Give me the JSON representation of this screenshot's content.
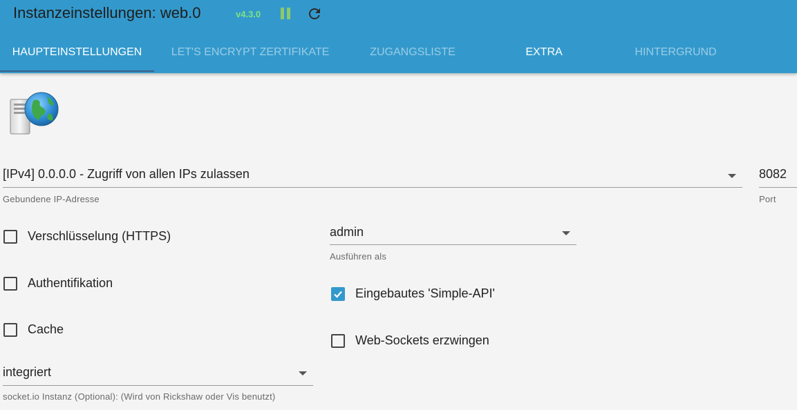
{
  "header": {
    "title": "Instanzeinstellungen: web.0",
    "version": "v4.3.0",
    "pause_icon": "pause-icon",
    "reload_icon": "reload-icon",
    "colors": {
      "header_bg": "#3399cc",
      "version": "#7ee37e",
      "pause": "#8cc96a"
    }
  },
  "tabs": [
    {
      "label": "HAUPTEINSTELLUNGEN",
      "active": true
    },
    {
      "label": "LET'S ENCRYPT ZERTIFIKATE",
      "active": false
    },
    {
      "label": "ZUGANGSLISTE",
      "active": false
    },
    {
      "label": "EXTRA",
      "active": false
    },
    {
      "label": "HINTERGRUND",
      "active": false
    }
  ],
  "logo": {
    "icon": "server-globe-icon"
  },
  "bind": {
    "value": "[IPv4] 0.0.0.0 - Zugriff von allen IPs zulassen",
    "helper": "Gebundene IP-Adresse"
  },
  "port": {
    "value": "8082",
    "helper": "Port"
  },
  "run_as": {
    "value": "admin",
    "helper": "Ausführen als"
  },
  "checkboxes": {
    "https": {
      "label": "Verschlüsselung (HTTPS)",
      "checked": false
    },
    "auth": {
      "label": "Authentifikation",
      "checked": false
    },
    "cache": {
      "label": "Cache",
      "checked": false
    },
    "simple_api": {
      "label": "Eingebautes 'Simple-API'",
      "checked": true
    },
    "force_ws": {
      "label": "Web-Sockets erzwingen",
      "checked": false
    }
  },
  "socketio": {
    "value": "integriert",
    "helper": "socket.io Instanz (Optional): (Wird von Rickshaw oder Vis benutzt)"
  }
}
